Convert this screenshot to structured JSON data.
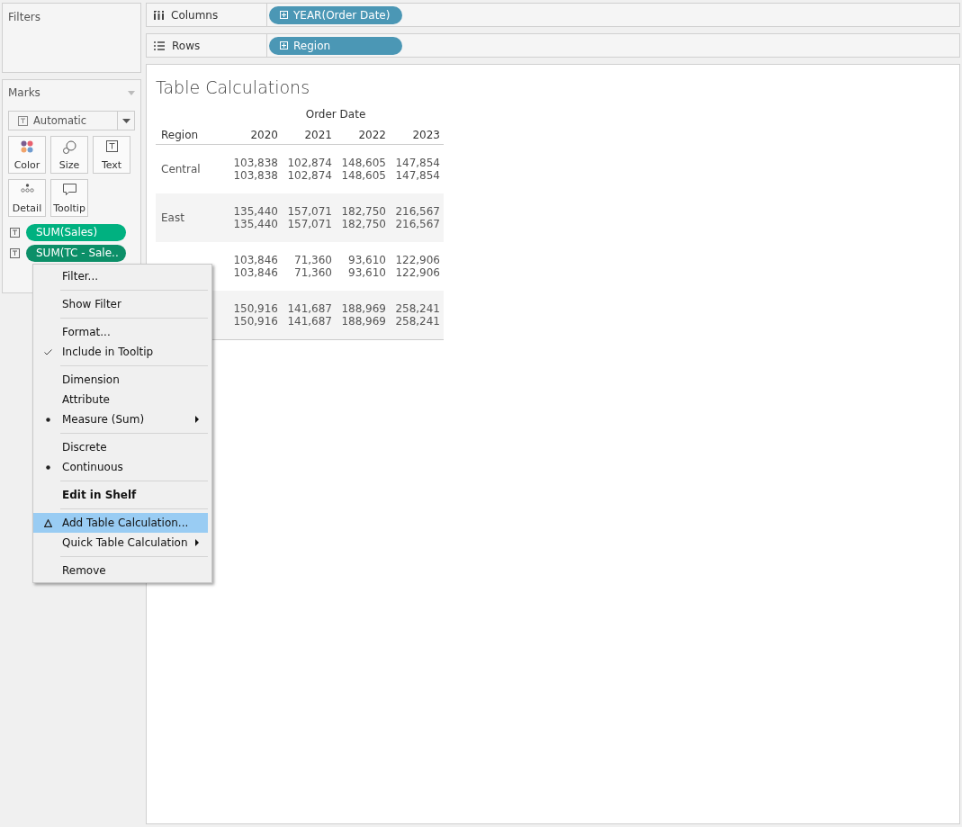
{
  "filters": {
    "title": "Filters"
  },
  "marks": {
    "title": "Automatic",
    "heading": "Marks",
    "cards": [
      {
        "kind": "color",
        "label": "Color"
      },
      {
        "kind": "size",
        "label": "Size"
      },
      {
        "kind": "text",
        "label": "Text"
      },
      {
        "kind": "detail",
        "label": "Detail"
      },
      {
        "kind": "tooltip",
        "label": "Tooltip"
      }
    ],
    "pills": [
      {
        "label": "SUM(Sales)",
        "color": "#00b180"
      },
      {
        "label": "SUM(TC - Sale..",
        "color": "#0c8f68"
      }
    ]
  },
  "shelves": [
    {
      "kind": "columns",
      "label": "Columns",
      "pill": "YEAR(Order Date)"
    },
    {
      "kind": "rows",
      "label": "Rows",
      "pill": "Region"
    }
  ],
  "view": {
    "title": "Table Calculations",
    "column_group": "Order Date",
    "row_header": "Region",
    "columns": [
      "2020",
      "2021",
      "2022",
      "2023"
    ],
    "rows": [
      {
        "region": "Central",
        "values": [
          [
            "103,838",
            "103,838"
          ],
          [
            "102,874",
            "102,874"
          ],
          [
            "148,605",
            "148,605"
          ],
          [
            "147,854",
            "147,854"
          ]
        ]
      },
      {
        "region": "East",
        "values": [
          [
            "135,440",
            "135,440"
          ],
          [
            "157,071",
            "157,071"
          ],
          [
            "182,750",
            "182,750"
          ],
          [
            "216,567",
            "216,567"
          ]
        ]
      },
      {
        "values": [
          [
            "103,846",
            "103,846"
          ],
          [
            "71,360",
            "71,360"
          ],
          [
            "93,610",
            "93,610"
          ],
          [
            "122,906",
            "122,906"
          ]
        ]
      },
      {
        "values": [
          [
            "150,916",
            "150,916"
          ],
          [
            "141,687",
            "141,687"
          ],
          [
            "188,969",
            "188,969"
          ],
          [
            "258,241",
            "258,241"
          ]
        ]
      }
    ]
  },
  "context_menu": {
    "groups": [
      [
        {
          "label": "Filter...",
          "kind": "plain",
          "checked": false,
          "submenu": false,
          "highlighted": false
        }
      ],
      [
        {
          "label": "Show Filter",
          "kind": "plain",
          "checked": false,
          "submenu": false,
          "highlighted": false
        }
      ],
      [
        {
          "label": "Format...",
          "kind": "plain",
          "checked": false,
          "submenu": false,
          "highlighted": false
        },
        {
          "label": "Include in Tooltip",
          "kind": "check",
          "checked": true,
          "submenu": false,
          "highlighted": false
        }
      ],
      [
        {
          "label": "Dimension",
          "kind": "radio",
          "checked": false,
          "submenu": false,
          "highlighted": false
        },
        {
          "label": "Attribute",
          "kind": "radio",
          "checked": false,
          "submenu": false,
          "highlighted": false
        },
        {
          "label": "Measure (Sum)",
          "kind": "radio",
          "checked": true,
          "submenu": true,
          "highlighted": false
        }
      ],
      [
        {
          "label": "Discrete",
          "kind": "radio",
          "checked": false,
          "submenu": false,
          "highlighted": false
        },
        {
          "label": "Continuous",
          "kind": "radio",
          "checked": true,
          "submenu": false,
          "highlighted": false
        }
      ],
      [
        {
          "label": "Edit in Shelf",
          "kind": "bold",
          "checked": false,
          "submenu": false,
          "highlighted": false
        }
      ],
      [
        {
          "label": "Add Table Calculation...",
          "kind": "calc",
          "checked": false,
          "submenu": false,
          "highlighted": true
        },
        {
          "label": "Quick Table Calculation",
          "kind": "plain",
          "checked": false,
          "submenu": true,
          "highlighted": false
        }
      ],
      [
        {
          "label": "Remove",
          "kind": "plain",
          "checked": false,
          "submenu": false,
          "highlighted": false
        }
      ]
    ]
  }
}
